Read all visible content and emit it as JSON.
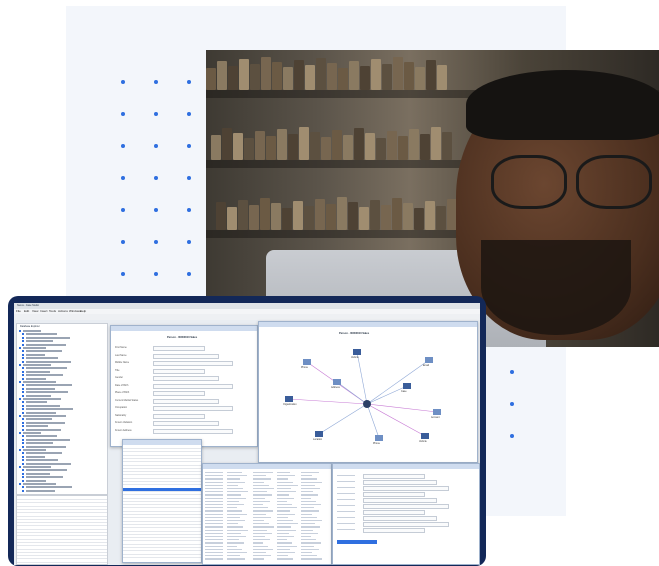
{
  "app": {
    "title": "Nexus - Case Studio",
    "menu": [
      "File",
      "Edit",
      "View",
      "Insert",
      "Tools",
      "Actions",
      "Windows",
      "Help"
    ],
    "tree_root": "Database Explorer"
  },
  "person_window": {
    "title": "Person - 00000010 Sales",
    "fields": [
      "First Name",
      "Last Name",
      "Middle Name",
      "Title",
      "Gender",
      "Date of Birth",
      "Place of Birth",
      "Current Marital Status",
      "Occupation",
      "Nationality",
      "Known Variation",
      "Known Address"
    ]
  },
  "graph_window": {
    "title": "Person - 00000010 Sales",
    "nodes": [
      "Phone",
      "Vehicle",
      "Email",
      "Organization",
      "Address",
      "Case",
      "Account",
      "Location"
    ]
  },
  "colors": {
    "accent": "#2f6fe0",
    "frame": "#132858",
    "panel": "#f3f6fb"
  }
}
